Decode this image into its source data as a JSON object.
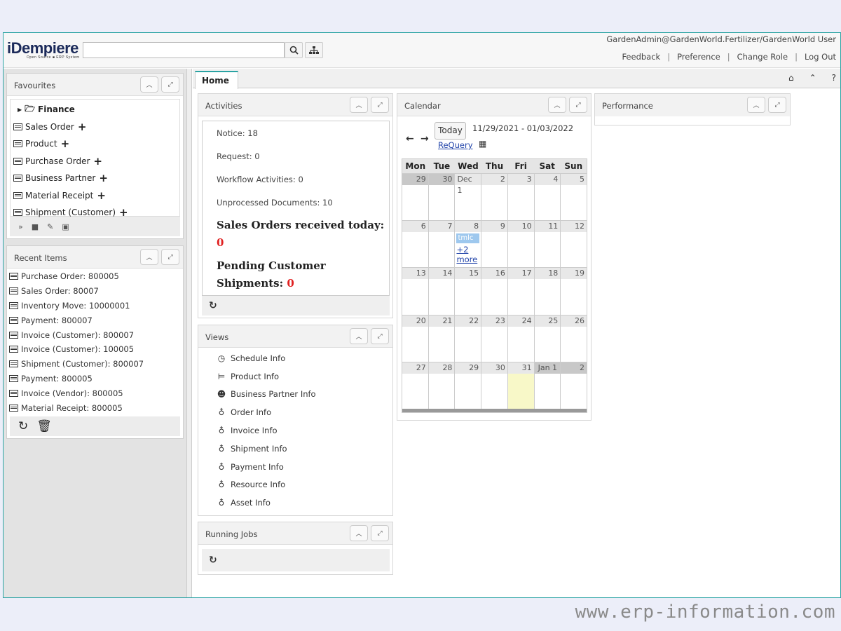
{
  "header": {
    "logo_main": "iDempiere",
    "logo_sub": "Open Source ■ ERP System",
    "search_value": "",
    "user": "GardenAdmin@GardenWorld.Fertilizer/GardenWorld User",
    "links": [
      "Feedback",
      "Preference",
      "Change Role",
      "Log Out"
    ],
    "search_icon": "search-icon",
    "tree_icon": "org-tree-icon"
  },
  "favourites": {
    "title": "Favourites",
    "folder": "Finance",
    "items": [
      "Sales Order",
      "Product",
      "Purchase Order",
      "Business Partner",
      "Material Receipt",
      "Shipment (Customer)"
    ]
  },
  "recent": {
    "title": "Recent Items",
    "items": [
      "Purchase Order: 800005",
      "Sales Order: 80007",
      "Inventory Move: 10000001",
      "Payment: 800007",
      "Invoice (Customer): 800007",
      "Invoice (Customer): 100005",
      "Shipment (Customer): 800007",
      "Payment: 800005",
      "Invoice (Vendor): 800005",
      "Material Receipt: 800005"
    ]
  },
  "tabs": {
    "home": "Home"
  },
  "activities": {
    "title": "Activities",
    "notice": "Notice: 18",
    "request": "Request: 0",
    "workflow": "Workflow Activities: 0",
    "unprocessed": "Unprocessed Documents: 10",
    "sales_label": "Sales Orders received today:",
    "sales_value": "0",
    "shipments_label": "Pending Customer Shipments:",
    "shipments_value": "0"
  },
  "views": {
    "title": "Views",
    "items": [
      {
        "label": "Schedule Info",
        "icon": "clock-icon"
      },
      {
        "label": "Product Info",
        "icon": "cart-icon"
      },
      {
        "label": "Business Partner Info",
        "icon": "users-icon"
      },
      {
        "label": "Order Info",
        "icon": "bulb-icon"
      },
      {
        "label": "Invoice Info",
        "icon": "bulb-icon"
      },
      {
        "label": "Shipment Info",
        "icon": "bulb-icon"
      },
      {
        "label": "Payment Info",
        "icon": "bulb-icon"
      },
      {
        "label": "Resource Info",
        "icon": "bulb-icon"
      },
      {
        "label": "Asset Info",
        "icon": "bulb-icon"
      }
    ]
  },
  "running_jobs": {
    "title": "Running Jobs"
  },
  "calendar": {
    "title": "Calendar",
    "today_btn": "Today",
    "range": "11/29/2021 - 01/03/2022",
    "requery": "ReQuery",
    "weekdays": [
      "Mon",
      "Tue",
      "Wed",
      "Thu",
      "Fri",
      "Sat",
      "Sun"
    ],
    "weeks": [
      [
        "29",
        "30",
        "Dec 1",
        "2",
        "3",
        "4",
        "5"
      ],
      [
        "6",
        "7",
        "8",
        "9",
        "10",
        "11",
        "12"
      ],
      [
        "13",
        "14",
        "15",
        "16",
        "17",
        "18",
        "19"
      ],
      [
        "20",
        "21",
        "22",
        "23",
        "24",
        "25",
        "26"
      ],
      [
        "27",
        "28",
        "29",
        "30",
        "31",
        "Jan 1",
        "2"
      ]
    ],
    "event_label": "tmlc",
    "more_label": "+2 more"
  },
  "performance": {
    "title": "Performance"
  },
  "watermark": "www.erp-information.com"
}
